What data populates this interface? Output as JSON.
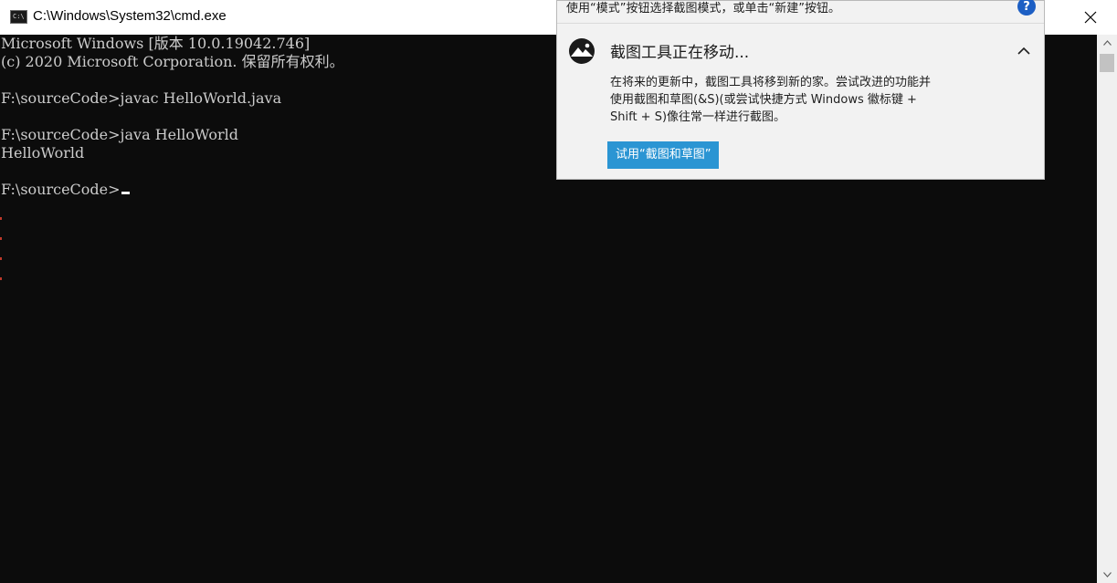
{
  "window": {
    "title": "C:\\Windows\\System32\\cmd.exe",
    "icon": "cmd-icon",
    "icon_text": "C:\\"
  },
  "console": {
    "lines": [
      "Microsoft Windows [版本 10.0.19042.746]",
      "(c) 2020 Microsoft Corporation. 保留所有权利。",
      "",
      "F:\\sourceCode>javac HelloWorld.java",
      "",
      "F:\\sourceCode>java HelloWorld",
      "HelloWorld",
      "",
      "F:\\sourceCode>"
    ],
    "text_color": "#cccccc",
    "background": "#0c0c0c"
  },
  "notification": {
    "top_text": "使用“模式”按钮选择截图模式，或单击“新建”按钮。",
    "help_icon": "help-icon",
    "help_glyph": "?",
    "title": "截图工具正在移动...",
    "body_lines": [
      "在将来的更新中，截图工具将移到新的家。尝试改进的功能并",
      "使用截图和草图(&S)(或尝试快捷方式 Windows 徽标键 +",
      "Shift + S)像往常一样进行截图。"
    ],
    "action_label": "试用“截图和草图”",
    "accent": "#2b95d3"
  }
}
